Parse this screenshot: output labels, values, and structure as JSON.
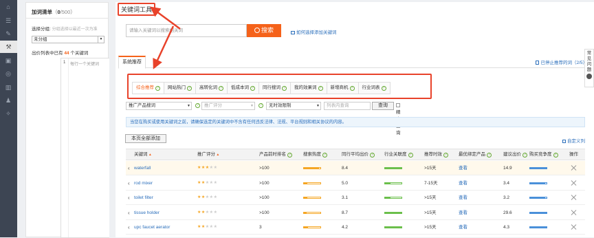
{
  "left_nav": {
    "icons": [
      "home-icon",
      "list-icon",
      "edit-icon",
      "wrench-icon",
      "box-icon",
      "target-icon",
      "chart-icon",
      "user-icon",
      "tool-icon"
    ]
  },
  "add_list": {
    "title": "加词清单",
    "count_open": "（",
    "count_current": "0",
    "count_total": "/500）",
    "group_label": "选择分组:",
    "group_hint": "分组选择以最近一次为准",
    "group_value": "未分组",
    "list_prefix": "出价列表中已有",
    "list_count": "44",
    "list_suffix": "个关键词",
    "line_no": "1",
    "textarea_placeholder": "每行一个关键词"
  },
  "main": {
    "title": "关键词工具",
    "search_placeholder": "请输入关键词以搜索相关词",
    "search_button": "搜索",
    "help_link": "如何选择添加关键词",
    "sys_tab": "系统推荐",
    "stopped_link": "已停止推荐的词（2/5）",
    "side_tab": [
      "常",
      "见",
      "问",
      "题"
    ]
  },
  "rec_tabs": [
    "综合推荐",
    "网站热门",
    "高转化词",
    "低成本词",
    "同行搜词",
    "我的效果词",
    "新增商机",
    "行业词表"
  ],
  "filters": {
    "product": "推广产品搜词",
    "rating_placeholder": "推广评分",
    "time": "无时效限制",
    "query_placeholder": "列表内查询",
    "query_button": "查询",
    "exact": "精确查询"
  },
  "notice": "当您在购买或使用关键词之前，请确保选定的关键词中不含有任何违反法律、法规、平台规则和相关协议的内容。",
  "add_all_button": "本页全部添加",
  "custom_column": "自定义列",
  "table": {
    "headers": [
      "关键词",
      "推广评分",
      "产品前时排名",
      "搜索热度",
      "同行平均出价",
      "行业关联度",
      "推荐时效",
      "最优绑定产品",
      "建议出价",
      "购买竞争度",
      "操作"
    ],
    "rows": [
      {
        "keyword": "waterfall",
        "stars": 3,
        "rank": ">100",
        "heat": 0.9,
        "avg_bid": "8.4",
        "relevance": 1.0,
        "timeliness": ">15天",
        "product": "查看",
        "suggest": "14.9",
        "competition": 1.0
      },
      {
        "keyword": "rod mixer",
        "stars": 2,
        "rank": ">100",
        "heat": 0.2,
        "avg_bid": "5.0",
        "relevance": 0.35,
        "timeliness": "7-15天",
        "product": "查看",
        "suggest": "3.4",
        "competition": 0.9
      },
      {
        "keyword": "toilet filter",
        "stars": 2,
        "rank": ">100",
        "heat": 0.2,
        "avg_bid": "3.1",
        "relevance": 0.35,
        "timeliness": ">15天",
        "product": "查看",
        "suggest": "3.2",
        "competition": 0.9
      },
      {
        "keyword": "tissue holder",
        "stars": 2,
        "rank": ">100",
        "heat": 0.15,
        "avg_bid": "8.7",
        "relevance": 1.0,
        "timeliness": ">15天",
        "product": "查看",
        "suggest": "29.6",
        "competition": 1.0
      },
      {
        "keyword": "upc faucet aerator",
        "stars": 2,
        "rank": "3",
        "heat": 0.25,
        "avg_bid": "4.2",
        "relevance": 1.0,
        "timeliness": ">15天",
        "product": "查看",
        "suggest": "4.3",
        "competition": 1.0
      }
    ]
  },
  "colors": {
    "accent": "#f5621a",
    "annotation_red": "#e8422a",
    "link_blue": "#2a6ebb",
    "nav_dark": "#3d4553"
  }
}
